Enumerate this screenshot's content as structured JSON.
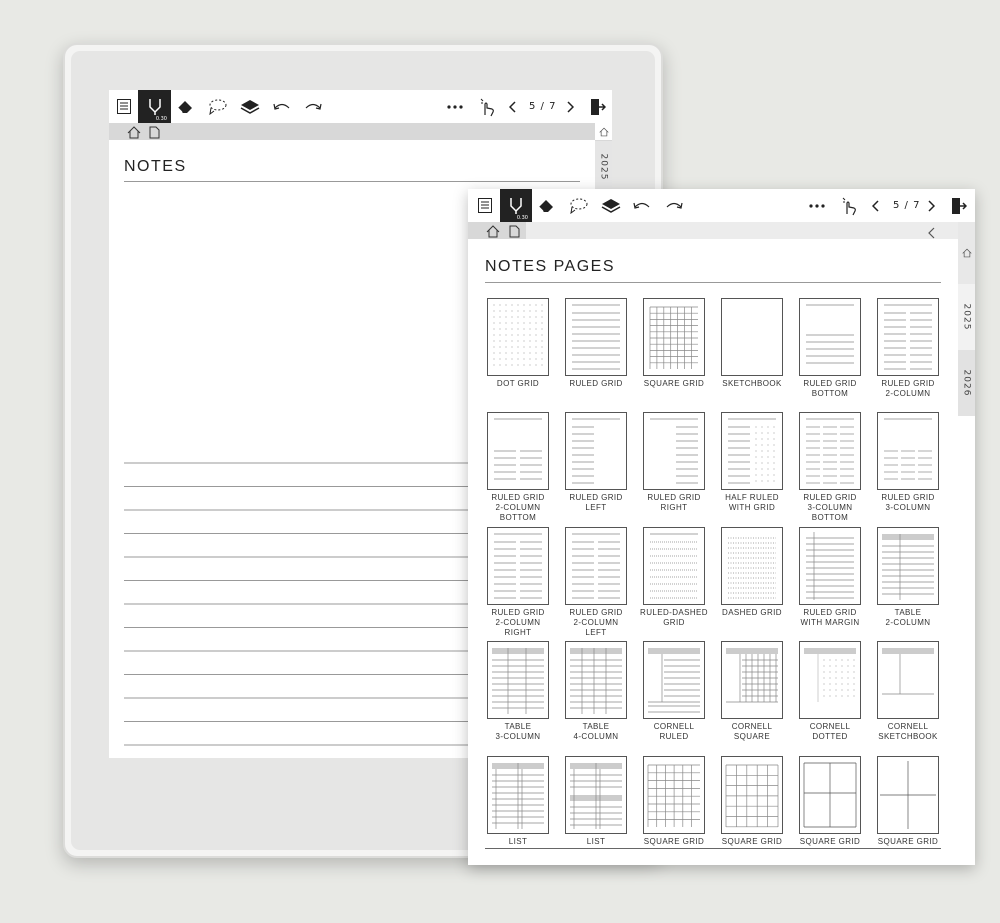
{
  "back_screen": {
    "toolbar": {
      "pen_size": "0.30",
      "page_indicator": "5 / 7"
    },
    "side_tabs": [
      "2025"
    ],
    "page_title": "NOTES"
  },
  "front_screen": {
    "toolbar": {
      "pen_size": "0.30",
      "page_indicator": "5 / 7"
    },
    "side_tabs": [
      "2025",
      "2026"
    ],
    "page_title": "NOTES PAGES",
    "templates": [
      {
        "label": "DOT GRID",
        "kind": "dot"
      },
      {
        "label": "RULED GRID",
        "kind": "ruled"
      },
      {
        "label": "SQUARE GRID",
        "kind": "square"
      },
      {
        "label": "SKETCHBOOK",
        "kind": "blank"
      },
      {
        "label": "RULED GRID\nBOTTOM",
        "kind": "ruled-bottom"
      },
      {
        "label": "RULED GRID\n2-COLUMN",
        "kind": "ruled-2col"
      },
      {
        "label": "RULED GRID\n2-COLUMN\nBOTTOM",
        "kind": "ruled-2col-bottom"
      },
      {
        "label": "RULED GRID\nLEFT",
        "kind": "ruled-left"
      },
      {
        "label": "RULED GRID\nRIGHT",
        "kind": "ruled-right"
      },
      {
        "label": "HALF RULED\nWITH GRID",
        "kind": "half-ruled"
      },
      {
        "label": "RULED GRID\n3-COLUMN\nBOTTOM",
        "kind": "ruled-3col-bottom"
      },
      {
        "label": "RULED GRID\n3-COLUMN",
        "kind": "ruled-3col"
      },
      {
        "label": "RULED GRID\n2-COLUMN\nRIGHT",
        "kind": "ruled-2col-right"
      },
      {
        "label": "RULED GRID\n2-COLUMN\nLEFT",
        "kind": "ruled-2col-left"
      },
      {
        "label": "RULED-DASHED\nGRID",
        "kind": "ruled-dashed"
      },
      {
        "label": "DASHED GRID",
        "kind": "dashed"
      },
      {
        "label": "RULED GRID\nWITH MARGIN",
        "kind": "margin"
      },
      {
        "label": "TABLE\n2-COLUMN",
        "kind": "table2"
      },
      {
        "label": "TABLE\n3-COLUMN",
        "kind": "table3"
      },
      {
        "label": "TABLE\n4-COLUMN",
        "kind": "table4"
      },
      {
        "label": "CORNELL\nRULED",
        "kind": "cornell-ruled"
      },
      {
        "label": "CORNELL\nSQUARE",
        "kind": "cornell-square"
      },
      {
        "label": "CORNELL\nDOTTED",
        "kind": "cornell-dotted"
      },
      {
        "label": "CORNELL\nSKETCHBOOK",
        "kind": "cornell-sketch"
      },
      {
        "label": "LIST",
        "kind": "list2"
      },
      {
        "label": "LIST",
        "kind": "list4"
      },
      {
        "label": "SQUARE GRID",
        "kind": "square-big"
      },
      {
        "label": "SQUARE GRID",
        "kind": "square-big2"
      },
      {
        "label": "SQUARE GRID",
        "kind": "quad"
      },
      {
        "label": "SQUARE GRID",
        "kind": "quad2"
      }
    ]
  }
}
